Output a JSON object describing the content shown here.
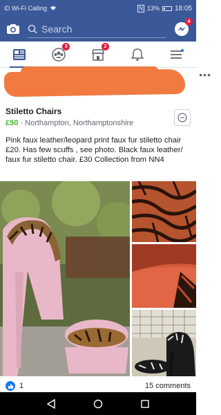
{
  "status": {
    "carrier": "iD Wi-Fi Calling",
    "battery": "13%",
    "time": "18:05"
  },
  "topbar": {
    "search_placeholder": "Search",
    "messenger_badge": "4"
  },
  "nav": {
    "groups_badge": "3",
    "marketplace_badge": "2"
  },
  "listing": {
    "title": "Stiletto Chairs",
    "price": "£50",
    "location": "Northampton, Northamptonshire",
    "description": "Pink faux leather/leopard print faux fur stiletto chair £20. Has few scuffs , see photo. Black faux leather/ faux fur stiletto chair. £30 Collection from NN4"
  },
  "footer": {
    "likes": "1",
    "comments": "15 comments"
  },
  "colors": {
    "brand": "#3b5998",
    "price_green": "#42b72a",
    "badge_red": "#e41e3f",
    "redaction": "#f07a40"
  }
}
